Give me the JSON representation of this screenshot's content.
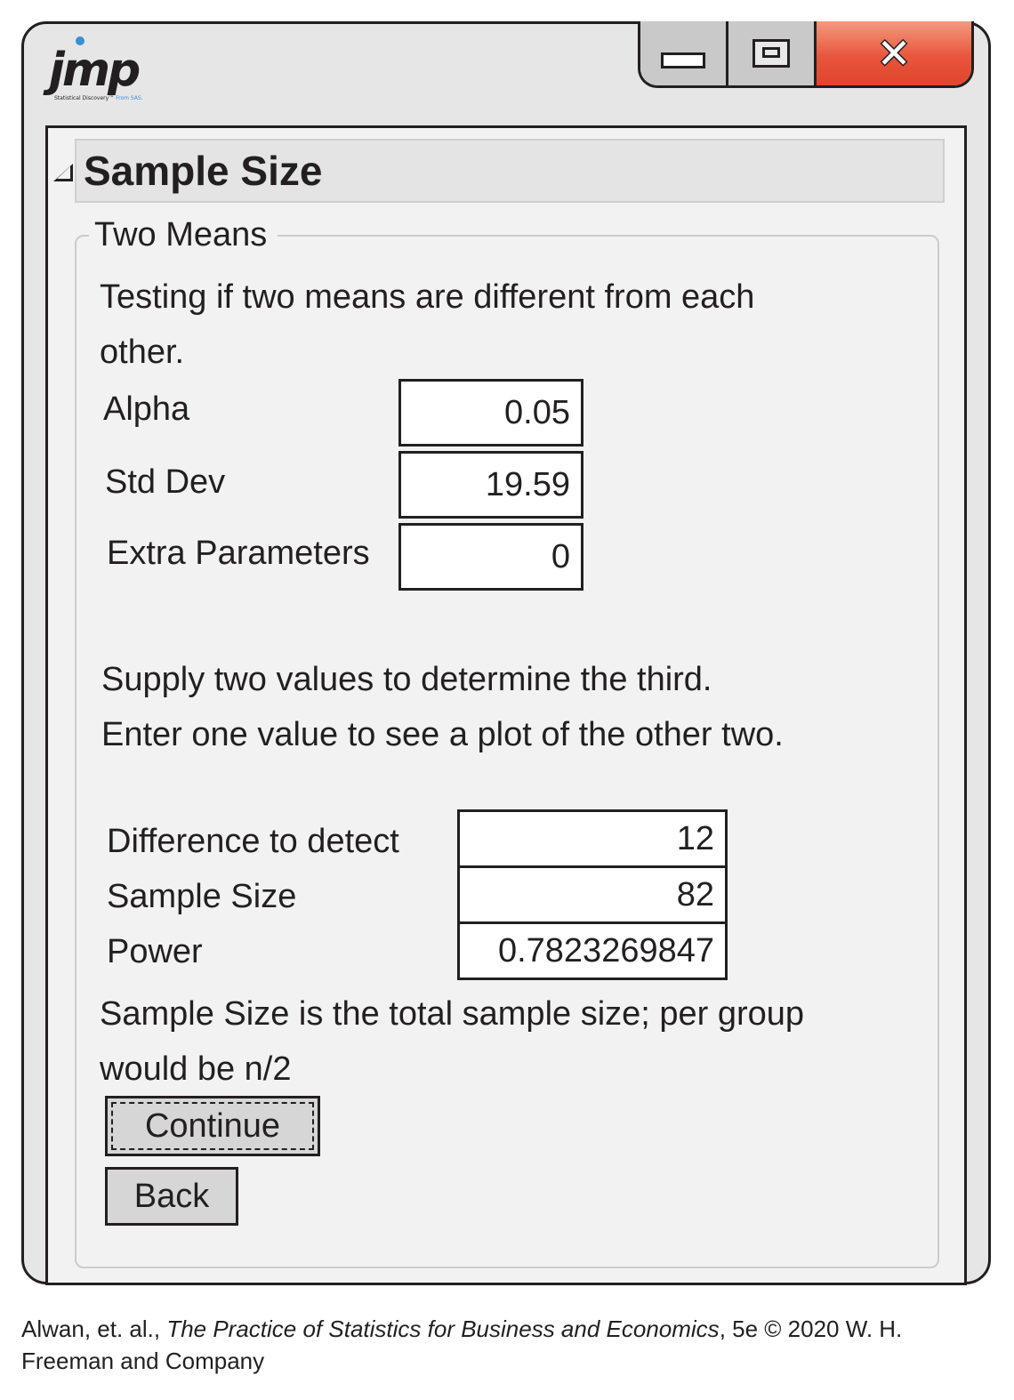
{
  "app": {
    "logo_text": "jmp",
    "logo_tagline": "Statistical Discovery™",
    "logo_from": "From SAS."
  },
  "window_controls": {
    "close_glyph": "✕"
  },
  "panel": {
    "title": "Sample Size",
    "group_label": "Two Means",
    "description": "Testing if  two means  are different  from each",
    "description_line2": "other.",
    "params": [
      {
        "label": "Alpha",
        "value": "0.05"
      },
      {
        "label": "Std Dev",
        "value": "19.59"
      },
      {
        "label": "Extra Parameters",
        "value": "0"
      }
    ],
    "instruction_1": "Supply  two values  to determine the  third.",
    "instruction_2": "Enter one  value to  see a plot  of the  other two.",
    "calc": [
      {
        "label": "Difference  to  detect",
        "value": "12"
      },
      {
        "label": "Sample Size",
        "value": "82"
      },
      {
        "label": "Power",
        "value": "0.7823269847"
      }
    ],
    "note_line1": "Sample  Size  is the  total  sample  size;  per  group",
    "note_line2": "would be  n/2",
    "continue_label": "Continue",
    "back_label": "Back"
  },
  "caption": {
    "authors": "Alwan, et. al., ",
    "book": "The Practice of Statistics for Business and Economics",
    "rest": ", 5e © 2020 W. H. Freeman and Company"
  }
}
